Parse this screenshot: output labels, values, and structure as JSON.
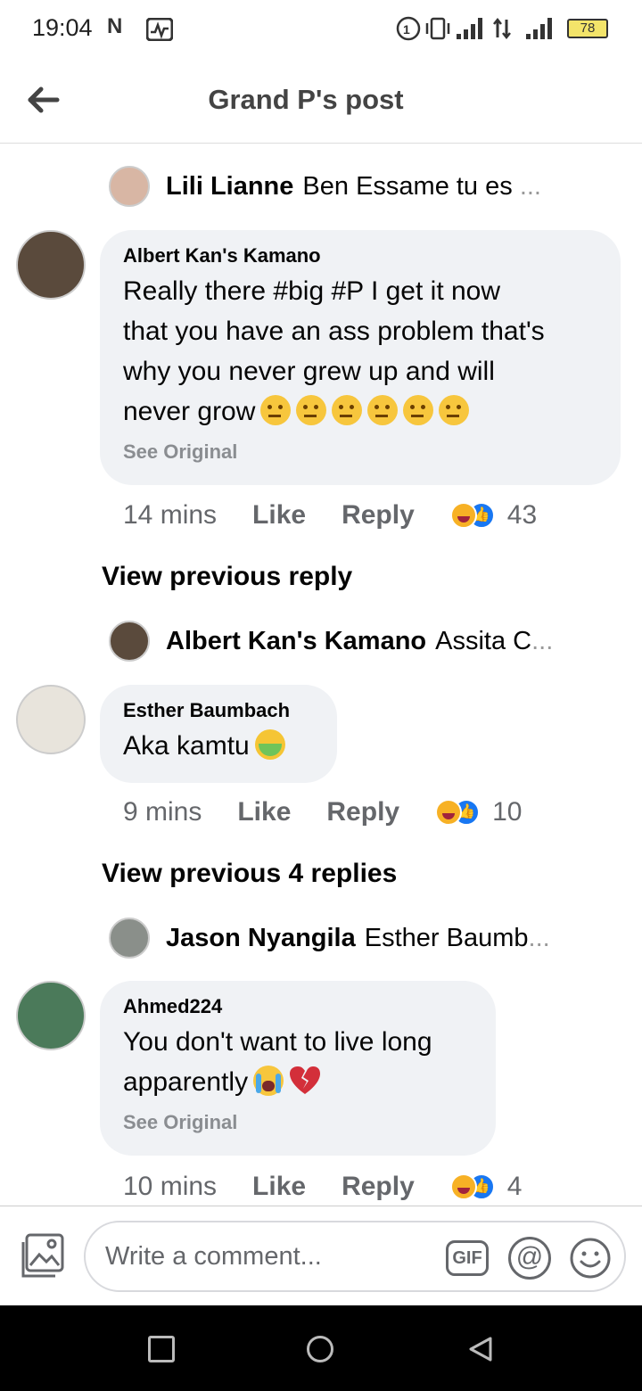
{
  "status_bar": {
    "time": "19:04",
    "notif_icons": [
      "n-app-icon",
      "activity-icon"
    ],
    "battery": "78"
  },
  "header": {
    "title": "Grand P's post"
  },
  "thread": [
    {
      "type": "reply_summary",
      "name": "Lili Lianne",
      "snippet": "Ben Essame tu es",
      "ellipsis": "..."
    },
    {
      "type": "comment",
      "author": "Albert Kan's Kamano",
      "text_lines": [
        "Really there #big #P I get it now",
        "that you have an ass problem that's",
        "why you never grew up and will",
        "never grow"
      ],
      "emojis": [
        "thinking-face",
        "thinking-face",
        "thinking-face",
        "thinking-face",
        "thinking-face",
        "thinking-face"
      ],
      "see_original": "See Original",
      "time": "14 mins",
      "like": "Like",
      "reply": "Reply",
      "reaction_count": "43"
    },
    {
      "type": "view_previous",
      "label": "View previous reply"
    },
    {
      "type": "reply_summary",
      "name": "Albert Kan's Kamano",
      "snippet": "Assita C",
      "ellipsis": "..."
    },
    {
      "type": "comment",
      "author": "Esther Baumbach",
      "text": "Aka kamtu",
      "emojis": [
        "nauseated-face"
      ],
      "time": "9 mins",
      "like": "Like",
      "reply": "Reply",
      "reaction_count": "10"
    },
    {
      "type": "view_previous",
      "label": "View previous 4 replies"
    },
    {
      "type": "reply_summary",
      "name": "Jason Nyangila",
      "snippet": "Esther Baumb",
      "ellipsis": "..."
    },
    {
      "type": "comment",
      "author": "Ahmed224",
      "text_lines": [
        "You don't want to live long",
        "apparently"
      ],
      "emojis": [
        "crying-face",
        "broken-heart"
      ],
      "see_original": "See Original",
      "time": "10 mins",
      "like": "Like",
      "reply": "Reply",
      "reaction_count": "4"
    }
  ],
  "comment_bar": {
    "placeholder": "Write a comment...",
    "gif_label": "GIF",
    "at_label": "@"
  },
  "colors": {
    "bubble": "#f0f2f5",
    "secondary_text": "#65676b",
    "like_blue": "#1877f2",
    "haha_yellow": "#f7b125"
  }
}
